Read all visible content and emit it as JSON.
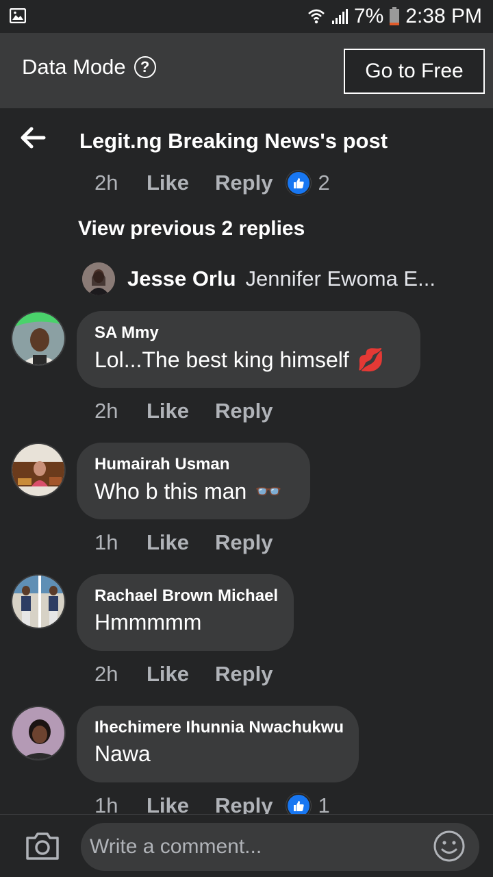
{
  "status_bar": {
    "battery": "7%",
    "time": "2:38 PM"
  },
  "data_mode": {
    "label": "Data Mode",
    "help_glyph": "?",
    "go_free": "Go to Free"
  },
  "header": {
    "title": "Legit.ng Breaking News's post"
  },
  "parent_meta": {
    "time": "2h",
    "like": "Like",
    "reply": "Reply",
    "reactions": "2"
  },
  "view_previous": "View previous 2 replies",
  "reply_preview": {
    "name": "Jesse Orlu",
    "text": "Jennifer Ewoma E..."
  },
  "comments": [
    {
      "name": "SA Mmy",
      "text": "Lol...The best king himself",
      "emoji": "💋",
      "time": "2h",
      "like": "Like",
      "reply": "Reply"
    },
    {
      "name": "Humairah Usman",
      "text": "Who b this man",
      "emoji": "👓",
      "time": "1h",
      "like": "Like",
      "reply": "Reply"
    },
    {
      "name": "Rachael Brown Michael",
      "text": "Hmmmmm",
      "time": "2h",
      "like": "Like",
      "reply": "Reply"
    },
    {
      "name": "Ihechimere Ihunnia Nwachukwu",
      "text": "Nawa",
      "time": "1h",
      "like": "Like",
      "reply": "Reply",
      "reactions": "1"
    }
  ],
  "composer": {
    "placeholder": "Write a comment..."
  },
  "colors": {
    "background": "#242526",
    "bubble": "#3a3b3c",
    "like_blue": "#1877f2",
    "meta_text": "#b0b3b8"
  }
}
